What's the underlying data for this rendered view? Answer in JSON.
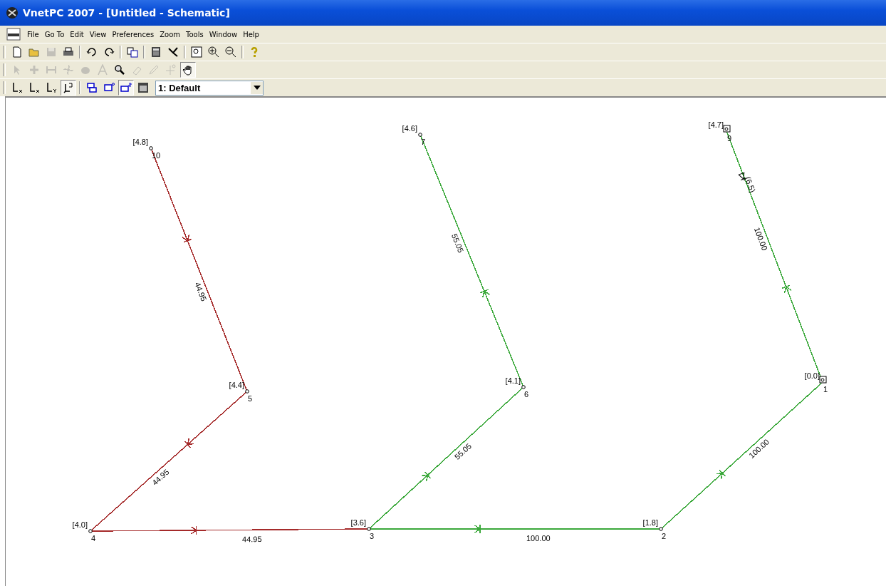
{
  "window": {
    "title": "VnetPC 2007 - [Untitled - Schematic]"
  },
  "menu": [
    "File",
    "Go To",
    "Edit",
    "View",
    "Preferences",
    "Zoom",
    "Tools",
    "Window",
    "Help"
  ],
  "toolbars": [
    [
      {
        "kind": "new-page",
        "selected": false,
        "disabled": false
      },
      {
        "kind": "open-folder",
        "selected": false,
        "disabled": false
      },
      {
        "kind": "floppy-disk",
        "selected": false,
        "disabled": true
      },
      {
        "kind": "printer",
        "selected": false,
        "disabled": false
      },
      {
        "kind": "separator"
      },
      {
        "kind": "undo",
        "selected": false,
        "disabled": false
      },
      {
        "kind": "redo",
        "selected": false,
        "disabled": false
      },
      {
        "kind": "separator"
      },
      {
        "kind": "copy",
        "selected": false,
        "disabled": false
      },
      {
        "kind": "separator"
      },
      {
        "kind": "calculator",
        "selected": false,
        "disabled": false
      },
      {
        "kind": "network",
        "selected": false,
        "disabled": false
      },
      {
        "kind": "separator"
      },
      {
        "kind": "zoom-fit",
        "selected": false,
        "disabled": false
      },
      {
        "kind": "zoom-in",
        "selected": false,
        "disabled": false
      },
      {
        "kind": "zoom-out",
        "selected": false,
        "disabled": false
      },
      {
        "kind": "separator"
      },
      {
        "kind": "help",
        "selected": false,
        "disabled": false
      }
    ],
    [
      {
        "kind": "pointer",
        "selected": false,
        "disabled": true
      },
      {
        "kind": "plus",
        "selected": false,
        "disabled": true
      },
      {
        "kind": "pipe",
        "selected": false,
        "disabled": true
      },
      {
        "kind": "fan",
        "selected": false,
        "disabled": true
      },
      {
        "kind": "blob",
        "selected": false,
        "disabled": true
      },
      {
        "kind": "text",
        "selected": false,
        "disabled": true
      },
      {
        "kind": "magnifier",
        "selected": false,
        "disabled": false
      },
      {
        "kind": "eraser",
        "selected": false,
        "disabled": true
      },
      {
        "kind": "pencil",
        "selected": false,
        "disabled": true
      },
      {
        "kind": "crosshair",
        "selected": false,
        "disabled": true
      },
      {
        "kind": "hand",
        "selected": true,
        "disabled": false
      }
    ],
    [
      {
        "kind": "axis-x",
        "selected": false,
        "disabled": false
      },
      {
        "kind": "axis-x",
        "selected": false,
        "disabled": false
      },
      {
        "kind": "axis-y",
        "selected": false,
        "disabled": false
      },
      {
        "kind": "axis-3d",
        "selected": true,
        "disabled": false
      },
      {
        "kind": "separator"
      },
      {
        "kind": "layers",
        "selected": false,
        "disabled": false
      },
      {
        "kind": "layer-up",
        "selected": false,
        "disabled": false
      },
      {
        "kind": "layer-down",
        "selected": true,
        "disabled": false
      },
      {
        "kind": "window",
        "selected": false,
        "disabled": false
      }
    ]
  ],
  "layer_select": {
    "value": "1: Default"
  },
  "nodes": [
    {
      "id": "10",
      "pressure": "[4.8]",
      "kind": "junction"
    },
    {
      "id": "7",
      "pressure": "[4.6]",
      "kind": "junction"
    },
    {
      "id": "9",
      "pressure": "[4.7]",
      "kind": "tank"
    },
    {
      "id": "5",
      "pressure": "[4.4]",
      "kind": "junction"
    },
    {
      "id": "6",
      "pressure": "[4.1]",
      "kind": "junction"
    },
    {
      "id": "1",
      "pressure": "[0.0]",
      "kind": "tank"
    },
    {
      "id": "4",
      "pressure": "[4.0]",
      "kind": "junction"
    },
    {
      "id": "3",
      "pressure": "[3.6]",
      "kind": "junction"
    },
    {
      "id": "2",
      "pressure": "[1.8]",
      "kind": "junction"
    }
  ],
  "pipes": [
    {
      "flow": "44.95",
      "color": "#a52a2a"
    },
    {
      "flow": "44.95",
      "color": "#a52a2a"
    },
    {
      "flow": "44.95",
      "color": "#a52a2a"
    },
    {
      "flow": "55.05",
      "color": "#3aa83a"
    },
    {
      "flow": "55.05",
      "color": "#3aa83a"
    },
    {
      "flow": "100.00",
      "color": "#3aa83a"
    },
    {
      "flow": "100.00",
      "color": "#3aa83a"
    },
    {
      "flow": "100.00",
      "color": "#3aa83a",
      "pump": "(6.5)"
    }
  ]
}
